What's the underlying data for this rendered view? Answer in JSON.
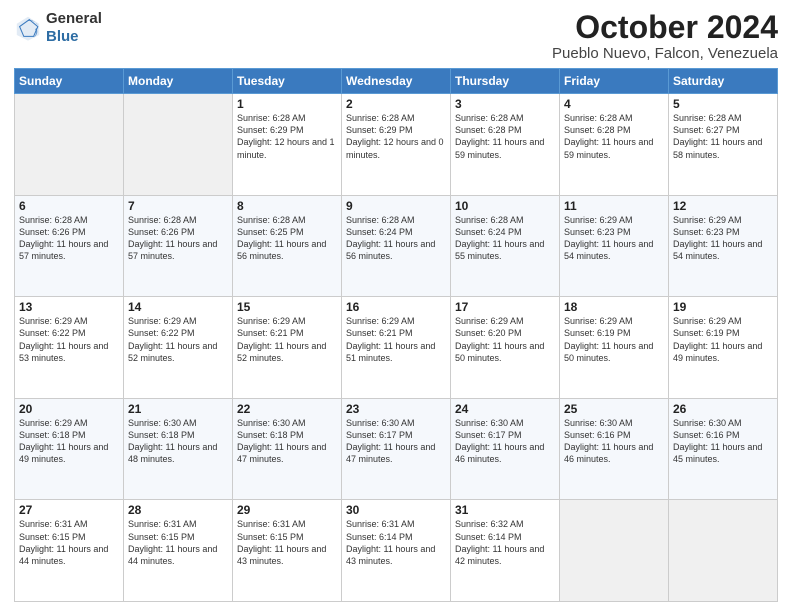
{
  "header": {
    "logo": {
      "general": "General",
      "blue": "Blue"
    },
    "title": "October 2024",
    "subtitle": "Pueblo Nuevo, Falcon, Venezuela"
  },
  "days_of_week": [
    "Sunday",
    "Monday",
    "Tuesday",
    "Wednesday",
    "Thursday",
    "Friday",
    "Saturday"
  ],
  "weeks": [
    [
      {
        "day": "",
        "info": ""
      },
      {
        "day": "",
        "info": ""
      },
      {
        "day": "1",
        "info": "Sunrise: 6:28 AM\nSunset: 6:29 PM\nDaylight: 12 hours and 1 minute."
      },
      {
        "day": "2",
        "info": "Sunrise: 6:28 AM\nSunset: 6:29 PM\nDaylight: 12 hours and 0 minutes."
      },
      {
        "day": "3",
        "info": "Sunrise: 6:28 AM\nSunset: 6:28 PM\nDaylight: 11 hours and 59 minutes."
      },
      {
        "day": "4",
        "info": "Sunrise: 6:28 AM\nSunset: 6:28 PM\nDaylight: 11 hours and 59 minutes."
      },
      {
        "day": "5",
        "info": "Sunrise: 6:28 AM\nSunset: 6:27 PM\nDaylight: 11 hours and 58 minutes."
      }
    ],
    [
      {
        "day": "6",
        "info": "Sunrise: 6:28 AM\nSunset: 6:26 PM\nDaylight: 11 hours and 57 minutes."
      },
      {
        "day": "7",
        "info": "Sunrise: 6:28 AM\nSunset: 6:26 PM\nDaylight: 11 hours and 57 minutes."
      },
      {
        "day": "8",
        "info": "Sunrise: 6:28 AM\nSunset: 6:25 PM\nDaylight: 11 hours and 56 minutes."
      },
      {
        "day": "9",
        "info": "Sunrise: 6:28 AM\nSunset: 6:24 PM\nDaylight: 11 hours and 56 minutes."
      },
      {
        "day": "10",
        "info": "Sunrise: 6:28 AM\nSunset: 6:24 PM\nDaylight: 11 hours and 55 minutes."
      },
      {
        "day": "11",
        "info": "Sunrise: 6:29 AM\nSunset: 6:23 PM\nDaylight: 11 hours and 54 minutes."
      },
      {
        "day": "12",
        "info": "Sunrise: 6:29 AM\nSunset: 6:23 PM\nDaylight: 11 hours and 54 minutes."
      }
    ],
    [
      {
        "day": "13",
        "info": "Sunrise: 6:29 AM\nSunset: 6:22 PM\nDaylight: 11 hours and 53 minutes."
      },
      {
        "day": "14",
        "info": "Sunrise: 6:29 AM\nSunset: 6:22 PM\nDaylight: 11 hours and 52 minutes."
      },
      {
        "day": "15",
        "info": "Sunrise: 6:29 AM\nSunset: 6:21 PM\nDaylight: 11 hours and 52 minutes."
      },
      {
        "day": "16",
        "info": "Sunrise: 6:29 AM\nSunset: 6:21 PM\nDaylight: 11 hours and 51 minutes."
      },
      {
        "day": "17",
        "info": "Sunrise: 6:29 AM\nSunset: 6:20 PM\nDaylight: 11 hours and 50 minutes."
      },
      {
        "day": "18",
        "info": "Sunrise: 6:29 AM\nSunset: 6:19 PM\nDaylight: 11 hours and 50 minutes."
      },
      {
        "day": "19",
        "info": "Sunrise: 6:29 AM\nSunset: 6:19 PM\nDaylight: 11 hours and 49 minutes."
      }
    ],
    [
      {
        "day": "20",
        "info": "Sunrise: 6:29 AM\nSunset: 6:18 PM\nDaylight: 11 hours and 49 minutes."
      },
      {
        "day": "21",
        "info": "Sunrise: 6:30 AM\nSunset: 6:18 PM\nDaylight: 11 hours and 48 minutes."
      },
      {
        "day": "22",
        "info": "Sunrise: 6:30 AM\nSunset: 6:18 PM\nDaylight: 11 hours and 47 minutes."
      },
      {
        "day": "23",
        "info": "Sunrise: 6:30 AM\nSunset: 6:17 PM\nDaylight: 11 hours and 47 minutes."
      },
      {
        "day": "24",
        "info": "Sunrise: 6:30 AM\nSunset: 6:17 PM\nDaylight: 11 hours and 46 minutes."
      },
      {
        "day": "25",
        "info": "Sunrise: 6:30 AM\nSunset: 6:16 PM\nDaylight: 11 hours and 46 minutes."
      },
      {
        "day": "26",
        "info": "Sunrise: 6:30 AM\nSunset: 6:16 PM\nDaylight: 11 hours and 45 minutes."
      }
    ],
    [
      {
        "day": "27",
        "info": "Sunrise: 6:31 AM\nSunset: 6:15 PM\nDaylight: 11 hours and 44 minutes."
      },
      {
        "day": "28",
        "info": "Sunrise: 6:31 AM\nSunset: 6:15 PM\nDaylight: 11 hours and 44 minutes."
      },
      {
        "day": "29",
        "info": "Sunrise: 6:31 AM\nSunset: 6:15 PM\nDaylight: 11 hours and 43 minutes."
      },
      {
        "day": "30",
        "info": "Sunrise: 6:31 AM\nSunset: 6:14 PM\nDaylight: 11 hours and 43 minutes."
      },
      {
        "day": "31",
        "info": "Sunrise: 6:32 AM\nSunset: 6:14 PM\nDaylight: 11 hours and 42 minutes."
      },
      {
        "day": "",
        "info": ""
      },
      {
        "day": "",
        "info": ""
      }
    ]
  ]
}
